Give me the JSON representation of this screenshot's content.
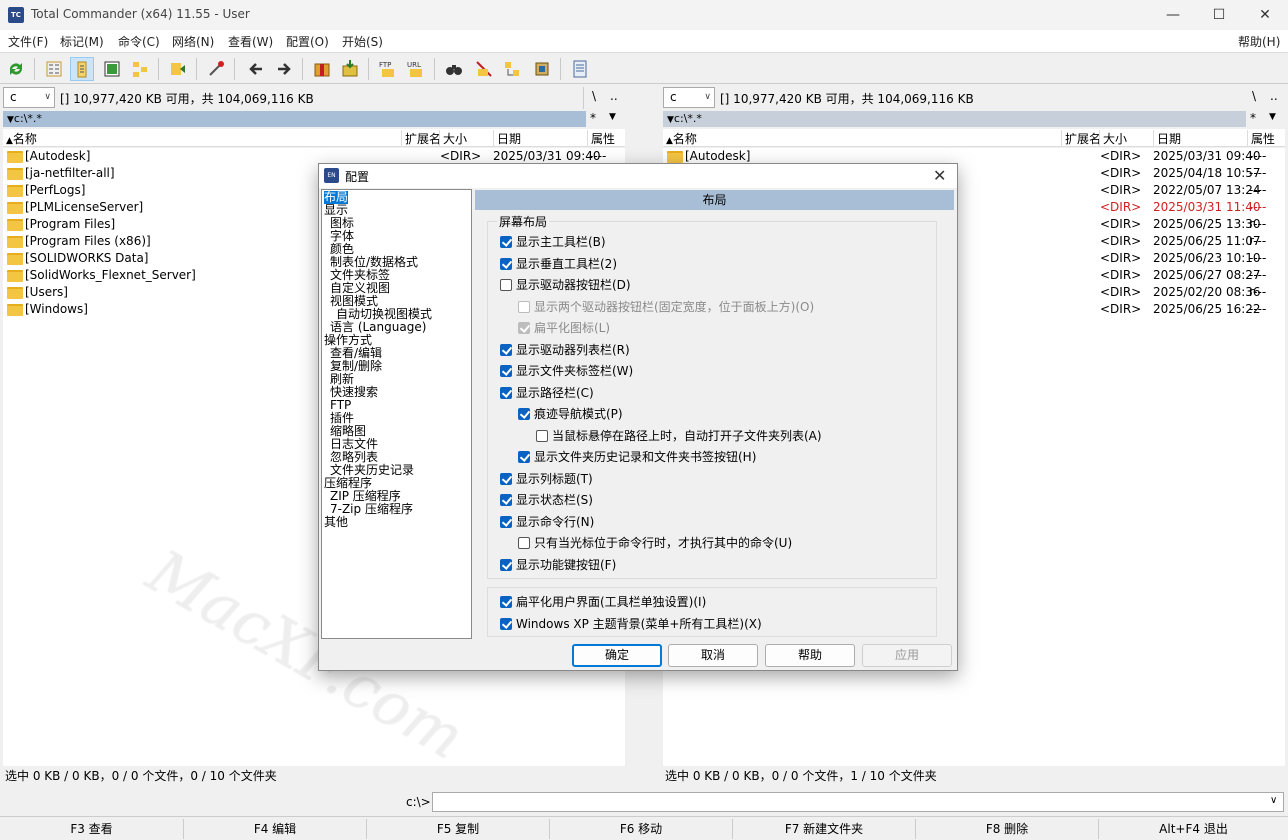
{
  "window": {
    "title": "Total Commander (x64) 11.55 - User",
    "minimize": "—",
    "maximize": "☐",
    "close": "✕"
  },
  "menu": {
    "items": [
      "文件(F)",
      "标记(M)",
      "命令(C)",
      "网络(N)",
      "查看(W)",
      "配置(O)",
      "开始(S)"
    ],
    "help": "帮助(H)"
  },
  "left_panel": {
    "drive": "c",
    "free_info": "[]  10,977,420 KB 可用，共 104,069,116 KB",
    "root_btn": "\\",
    "up_btn": "..",
    "path": "c:\\*.*",
    "filter_btn": "*",
    "columns": {
      "name": "名称",
      "ext": "扩展名",
      "size": "大小",
      "date": "日期",
      "attr": "属性"
    },
    "rows": [
      {
        "name": "[Autodesk]",
        "size": "<DIR>",
        "date": "2025/03/31 09:40",
        "attr": "----"
      },
      {
        "name": "[ja-netfilter-all]"
      },
      {
        "name": "[PerfLogs]"
      },
      {
        "name": "[PLMLicenseServer]"
      },
      {
        "name": "[Program Files]"
      },
      {
        "name": "[Program Files (x86)]"
      },
      {
        "name": "[SOLIDWORKS Data]"
      },
      {
        "name": "[SolidWorks_Flexnet_Server]"
      },
      {
        "name": "[Users]"
      },
      {
        "name": "[Windows]"
      }
    ],
    "status": "选中 0 KB / 0 KB，0 / 0 个文件，0 / 10 个文件夹"
  },
  "right_panel": {
    "drive": "c",
    "free_info": "[]  10,977,420 KB 可用，共 104,069,116 KB",
    "root_btn": "\\",
    "up_btn": "..",
    "path": "c:\\*.*",
    "filter_btn": "*",
    "columns": {
      "name": "名称",
      "ext": "扩展名",
      "size": "大小",
      "date": "日期",
      "attr": "属性"
    },
    "rows": [
      {
        "name": "[Autodesk]",
        "size": "<DIR>",
        "date": "2025/03/31 09:40",
        "attr": "----"
      },
      {
        "name": "",
        "size": "<DIR>",
        "date": "2025/04/18 10:57",
        "attr": "----"
      },
      {
        "name": "",
        "size": "<DIR>",
        "date": "2022/05/07 13:24",
        "attr": "----"
      },
      {
        "name": "",
        "size": "<DIR>",
        "date": "2025/03/31 11:40",
        "attr": "----",
        "highlight": true
      },
      {
        "name": "",
        "size": "<DIR>",
        "date": "2025/06/25 13:30",
        "attr": "r---"
      },
      {
        "name": "",
        "size": "<DIR>",
        "date": "2025/06/25 11:07",
        "attr": "r---"
      },
      {
        "name": "",
        "size": "<DIR>",
        "date": "2025/06/23 10:10",
        "attr": "----"
      },
      {
        "name": "",
        "size": "<DIR>",
        "date": "2025/06/27 08:27",
        "attr": "----"
      },
      {
        "name": "",
        "size": "<DIR>",
        "date": "2025/02/20 08:36",
        "attr": "r---"
      },
      {
        "name": "",
        "size": "<DIR>",
        "date": "2025/06/25 16:22",
        "attr": "----"
      }
    ],
    "status": "选中 0 KB / 0 KB，0 / 0 个文件，1 / 10 个文件夹"
  },
  "cmdline": {
    "prompt": "c:\\>",
    "value": ""
  },
  "fkeys": [
    "F3 查看",
    "F4 编辑",
    "F5 复制",
    "F6 移动",
    "F7 新建文件夹",
    "F8 删除",
    "Alt+F4 退出"
  ],
  "dialog": {
    "title": "配置",
    "close": "✕",
    "tree": [
      {
        "label": "布局",
        "selected": true,
        "level": 0
      },
      {
        "label": "显示",
        "level": 0
      },
      {
        "label": "图标",
        "level": 1
      },
      {
        "label": "字体",
        "level": 1
      },
      {
        "label": "颜色",
        "level": 1
      },
      {
        "label": "制表位/数据格式",
        "level": 1
      },
      {
        "label": "文件夹标签",
        "level": 1
      },
      {
        "label": "自定义视图",
        "level": 1
      },
      {
        "label": "视图模式",
        "level": 1
      },
      {
        "label": "自动切换视图模式",
        "level": 2
      },
      {
        "label": "语言 (Language)",
        "level": 1
      },
      {
        "label": "操作方式",
        "level": 0
      },
      {
        "label": "查看/编辑",
        "level": 1
      },
      {
        "label": "复制/删除",
        "level": 1
      },
      {
        "label": "刷新",
        "level": 1
      },
      {
        "label": "快速搜索",
        "level": 1
      },
      {
        "label": "FTP",
        "level": 1
      },
      {
        "label": "插件",
        "level": 1
      },
      {
        "label": "缩略图",
        "level": 1
      },
      {
        "label": "日志文件",
        "level": 1
      },
      {
        "label": "忽略列表",
        "level": 1
      },
      {
        "label": "文件夹历史记录",
        "level": 1
      },
      {
        "label": "压缩程序",
        "level": 0
      },
      {
        "label": "ZIP 压缩程序",
        "level": 1
      },
      {
        "label": "7-Zip 压缩程序",
        "level": 1
      },
      {
        "label": "其他",
        "level": 0
      }
    ],
    "section_header": "布局",
    "group_label": "屏幕布局",
    "options": [
      {
        "label": "显示主工具栏(B)",
        "checked": true,
        "indent": 0
      },
      {
        "label": "显示垂直工具栏(2)",
        "checked": true,
        "indent": 0
      },
      {
        "label": "显示驱动器按钮栏(D)",
        "checked": false,
        "indent": 0
      },
      {
        "label": "显示两个驱动器按钮栏(固定宽度，位于面板上方)(O)",
        "checked": false,
        "indent": 1,
        "disabled": true
      },
      {
        "label": "扁平化图标(L)",
        "checked": true,
        "indent": 1,
        "disabled": true
      },
      {
        "label": "显示驱动器列表栏(R)",
        "checked": true,
        "indent": 0
      },
      {
        "label": "显示文件夹标签栏(W)",
        "checked": true,
        "indent": 0
      },
      {
        "label": "显示路径栏(C)",
        "checked": true,
        "indent": 0
      },
      {
        "label": "痕迹导航模式(P)",
        "checked": true,
        "indent": 1
      },
      {
        "label": "当鼠标悬停在路径上时，自动打开子文件夹列表(A)",
        "checked": false,
        "indent": 2
      },
      {
        "label": "显示文件夹历史记录和文件夹书签按钮(H)",
        "checked": true,
        "indent": 1
      },
      {
        "label": "显示列标题(T)",
        "checked": true,
        "indent": 0
      },
      {
        "label": "显示状态栏(S)",
        "checked": true,
        "indent": 0
      },
      {
        "label": "显示命令行(N)",
        "checked": true,
        "indent": 0
      },
      {
        "label": "只有当光标位于命令行时，才执行其中的命令(U)",
        "checked": false,
        "indent": 1
      },
      {
        "label": "显示功能键按钮(F)",
        "checked": true,
        "indent": 0
      }
    ],
    "options2": [
      {
        "label": "扁平化用户界面(工具栏单独设置)(I)",
        "checked": true
      },
      {
        "label": "Windows XP 主题背景(菜单+所有工具栏)(X)",
        "checked": true
      }
    ],
    "buttons": {
      "ok": "确定",
      "cancel": "取消",
      "help": "帮助",
      "apply": "应用"
    }
  },
  "watermark": "MacXF.com"
}
